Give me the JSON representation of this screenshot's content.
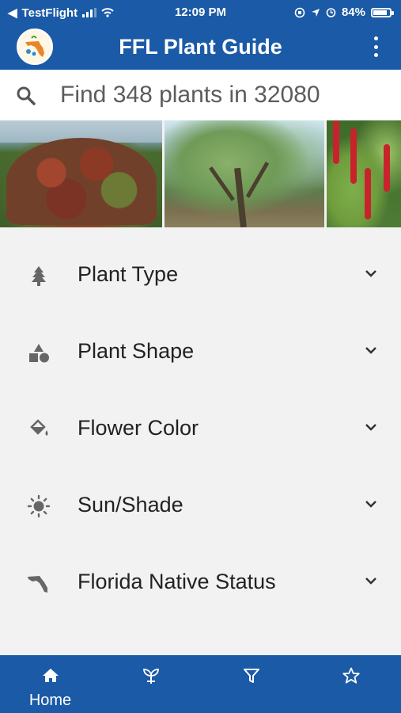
{
  "status_bar": {
    "back_app": "TestFlight",
    "time": "12:09 PM",
    "battery": "84%",
    "battery_level": 0.84
  },
  "app_bar": {
    "title": "FFL Plant Guide",
    "logo": "florida-logo-icon",
    "menu_icon": "more-vertical-icon"
  },
  "search": {
    "placeholder": "Find 348 plants in 32080",
    "value": "",
    "icon": "search-icon"
  },
  "filters": [
    {
      "label": "Plant Type",
      "icon": "tree-icon"
    },
    {
      "label": "Plant Shape",
      "icon": "shapes-icon"
    },
    {
      "label": "Flower Color",
      "icon": "paint-bucket-icon"
    },
    {
      "label": "Sun/Shade",
      "icon": "sun-icon"
    },
    {
      "label": "Florida Native Status",
      "icon": "florida-icon"
    }
  ],
  "tabs": [
    {
      "label": "Home",
      "icon": "home-icon",
      "selected": true
    },
    {
      "label": "",
      "icon": "sprout-icon",
      "selected": false
    },
    {
      "label": "",
      "icon": "filter-icon",
      "selected": false
    },
    {
      "label": "",
      "icon": "star-icon",
      "selected": false
    }
  ],
  "colors": {
    "brand_blue": "#1b5aa6",
    "background": "#f2f2f2",
    "icon_gray": "#666666"
  }
}
